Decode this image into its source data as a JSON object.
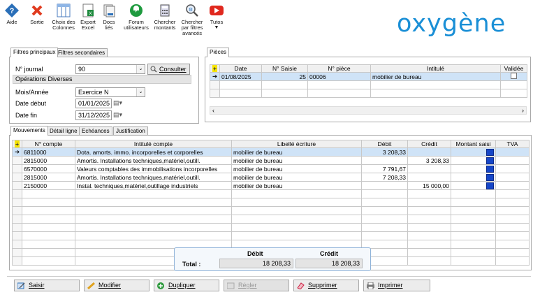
{
  "toolbar": {
    "items": [
      {
        "label": "Aide",
        "icon": "help-icon"
      },
      {
        "label": "Sortie",
        "icon": "exit-icon"
      },
      {
        "label": "Choix des Colonnes",
        "icon": "columns-icon"
      },
      {
        "label": "Export Excel",
        "icon": "excel-icon"
      },
      {
        "label": "Docs liés",
        "icon": "docs-icon"
      },
      {
        "label": "Forum utilisateurs",
        "icon": "forum-icon"
      },
      {
        "label": "Chercher montants",
        "icon": "calculator-icon"
      },
      {
        "label": "Chercher par filtres avancés",
        "icon": "advanced-search-icon"
      },
      {
        "label": "Tutos",
        "icon": "youtube-icon"
      }
    ]
  },
  "logo": "oxygène",
  "filters": {
    "tabs": [
      "Filtres principaux",
      "Filtres secondaires"
    ],
    "journal_label": "N° journal",
    "journal_value": "90",
    "consult_label": "Consulter",
    "journal_name": "Opérations Diverses",
    "period_label": "Mois/Année",
    "period_value": "Exercice N",
    "start_label": "Date début",
    "start_value": "01/01/2025",
    "end_label": "Date fin",
    "end_value": "31/12/2025"
  },
  "pieces": {
    "tab": "Pièces",
    "headers": [
      "Date",
      "N° Saisie",
      "N° pièce",
      "Intitulé",
      "Validée"
    ],
    "rows": [
      {
        "date": "01/08/2025",
        "saisie": "25",
        "piece": "00006",
        "intitule": "mobilier de bureau"
      }
    ]
  },
  "movements": {
    "tabs": [
      "Mouvements",
      "Détail ligne",
      "Echéances",
      "Justification"
    ],
    "headers": [
      "N° compte",
      "Intitulé compte",
      "Libellé écriture",
      "Débit",
      "Crédit",
      "Montant saisi",
      "TVA"
    ],
    "rows": [
      {
        "compte": "6811000",
        "intitule": "Dota. amorts. immo. incorporelles et corporelles",
        "libelle": "mobilier de bureau",
        "debit": "3 208,33",
        "credit": ""
      },
      {
        "compte": "2815000",
        "intitule": "Amortis. Installations techniques,matériel,outill.",
        "libelle": "mobilier de bureau",
        "debit": "",
        "credit": "3 208,33"
      },
      {
        "compte": "6570000",
        "intitule": "Valeurs comptables des immobilisations incorporelles",
        "libelle": "mobilier de bureau",
        "debit": "7 791,67",
        "credit": ""
      },
      {
        "compte": "2815000",
        "intitule": "Amortis. Installations techniques,matériel,outill.",
        "libelle": "mobilier de bureau",
        "debit": "7 208,33",
        "credit": ""
      },
      {
        "compte": "2150000",
        "intitule": "Instal. techniques,matériel,outillage industriels",
        "libelle": "mobilier de bureau",
        "debit": "",
        "credit": "15 000,00"
      }
    ]
  },
  "totals": {
    "label": "Total :",
    "debit_header": "Débit",
    "credit_header": "Crédit",
    "debit": "18 208,33",
    "credit": "18 208,33"
  },
  "actions": {
    "saisir": "Saisir",
    "modifier": "Modifier",
    "dupliquer": "Dupliquer",
    "regler": "Régler",
    "supprimer": "Supprimer",
    "imprimer": "Imprimer"
  },
  "colors": {
    "accent": "#1a8fd6",
    "selection": "#cfe3f7"
  }
}
